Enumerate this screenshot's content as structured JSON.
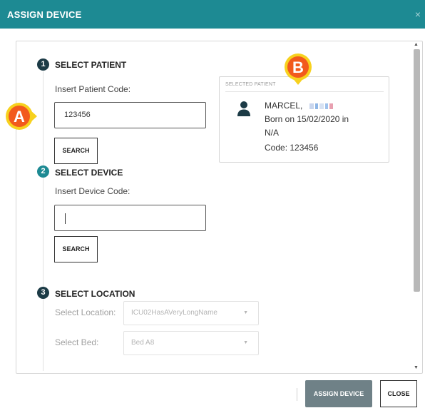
{
  "dialog": {
    "title": "ASSIGN DEVICE",
    "close_glyph": "×"
  },
  "steps": [
    {
      "number": "1",
      "title": "SELECT PATIENT",
      "input_label": "Insert Patient Code:",
      "input_value": "123456",
      "search_label": "SEARCH",
      "badge_color": "#1c3b46"
    },
    {
      "number": "2",
      "title": "SELECT DEVICE",
      "input_label": "Insert Device Code:",
      "input_value": "",
      "search_label": "SEARCH",
      "badge_color": "#1d8a93"
    },
    {
      "number": "3",
      "title": "SELECT LOCATION",
      "location_label": "Select Location:",
      "location_value": "ICU02HasAVeryLongName",
      "bed_label": "Select Bed:",
      "bed_value": "Bed A8",
      "badge_color": "#1c3b46"
    }
  ],
  "selected_patient": {
    "header": "SELECTED PATIENT",
    "name": "MARCEL,",
    "born": "Born on 15/02/2020 in",
    "place": "N/A",
    "code": "Code: 123456",
    "icon": "person-icon"
  },
  "footer": {
    "assign_label": "ASSIGN DEVICE",
    "close_label": "CLOSE"
  },
  "callouts": {
    "a": "A",
    "b": "B"
  },
  "colors": {
    "header": "#1d8a93",
    "primary_button": "#6f8187",
    "callout_fill": "#f25a1c",
    "callout_ring": "#f7d11e"
  }
}
